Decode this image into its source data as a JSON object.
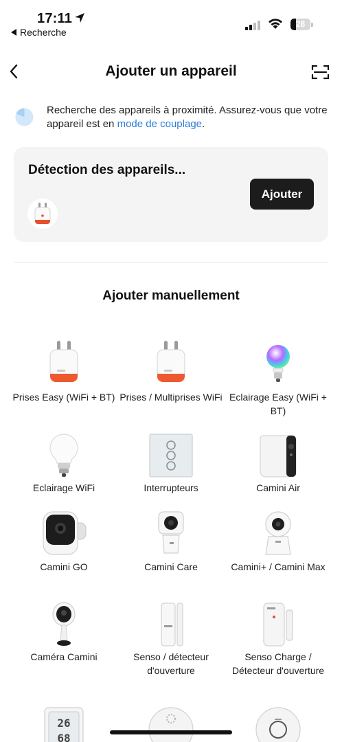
{
  "status_bar": {
    "time": "17:11",
    "back_app": "Recherche",
    "battery_level": "28",
    "battery_percent": 28,
    "signal_bars_active": 2,
    "signal_bars_total": 4
  },
  "header": {
    "title": "Ajouter un appareil",
    "back_icon": "chevron-left-icon",
    "scan_icon": "scan-icon"
  },
  "info": {
    "text": "Recherche des appareils à proximité. Assurez-vous que votre appareil est en ",
    "link": "mode de couplage",
    "suffix": "."
  },
  "detection": {
    "title": "Détection des appareils...",
    "add_button": "Ajouter",
    "device_icon": "smart-plug-icon"
  },
  "manual": {
    "title": "Ajouter manuellement",
    "items": [
      {
        "label": "Prises Easy (WiFi + BT)",
        "icon": "smart-plug-icon"
      },
      {
        "label": "Prises / Multiprises WiFi",
        "icon": "smart-plug-icon"
      },
      {
        "label": "Eclairage Easy (WiFi + BT)",
        "icon": "color-bulb-icon"
      },
      {
        "label": "Eclairage WiFi",
        "icon": "bulb-icon"
      },
      {
        "label": "Interrupteurs",
        "icon": "wall-switch-icon"
      },
      {
        "label": "Camini Air",
        "icon": "outdoor-camera-icon"
      },
      {
        "label": "Camini GO",
        "icon": "battery-camera-icon"
      },
      {
        "label": "Camini Care",
        "icon": "indoor-camera-icon"
      },
      {
        "label": "Camini+ / Camini Max",
        "icon": "pan-tilt-camera-icon"
      },
      {
        "label": "Caméra Camini",
        "icon": "dome-camera-icon"
      },
      {
        "label": "Senso / détecteur d'ouverture",
        "icon": "door-sensor-icon"
      },
      {
        "label": "Senso Charge / Détecteur d'ouverture",
        "icon": "door-sensor-charge-icon"
      },
      {
        "label": "",
        "icon": "thermometer-display-icon"
      },
      {
        "label": "",
        "icon": "smoke-detector-icon"
      },
      {
        "label": "",
        "icon": "smoke-detector-icon"
      }
    ],
    "row5_display": {
      "top": "26",
      "bottom": "68"
    }
  }
}
